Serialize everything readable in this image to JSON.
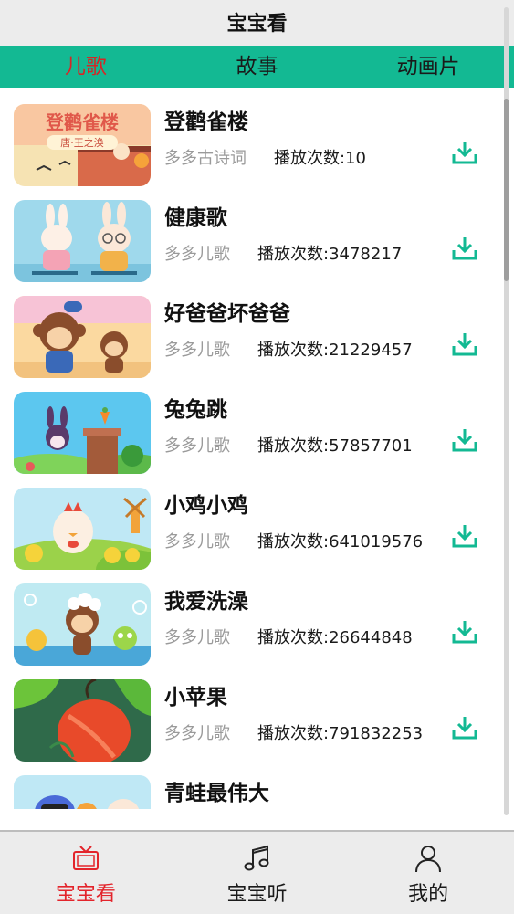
{
  "header": {
    "title": "宝宝看"
  },
  "tabs": [
    {
      "label": "儿歌",
      "active": true
    },
    {
      "label": "故事",
      "active": false
    },
    {
      "label": "动画片",
      "active": false
    }
  ],
  "songs": [
    {
      "title": "登鹳雀楼",
      "category": "多多古诗词",
      "plays": "播放次数:10"
    },
    {
      "title": "健康歌",
      "category": "多多儿歌",
      "plays": "播放次数:3478217"
    },
    {
      "title": "好爸爸坏爸爸",
      "category": "多多儿歌",
      "plays": "播放次数:21229457"
    },
    {
      "title": "兔兔跳",
      "category": "多多儿歌",
      "plays": "播放次数:57857701"
    },
    {
      "title": "小鸡小鸡",
      "category": "多多儿歌",
      "plays": "播放次数:641019576"
    },
    {
      "title": "我爱洗澡",
      "category": "多多儿歌",
      "plays": "播放次数:26644848"
    },
    {
      "title": "小苹果",
      "category": "多多儿歌",
      "plays": "播放次数:791832253"
    },
    {
      "title": "青蛙最伟大",
      "category": "",
      "plays": ""
    }
  ],
  "thumbnail_text": {
    "poem_title": "登鹳雀楼",
    "poem_subtitle": "唐·王之涣"
  },
  "bottom_nav": [
    {
      "label": "宝宝看",
      "icon": "tv-icon",
      "active": true
    },
    {
      "label": "宝宝听",
      "icon": "music-note-icon",
      "active": false
    },
    {
      "label": "我的",
      "icon": "user-icon",
      "active": false
    }
  ],
  "colors": {
    "accent": "#13b993",
    "active_tab": "#d62626",
    "active_nav": "#e3242b",
    "download": "#13b993"
  }
}
